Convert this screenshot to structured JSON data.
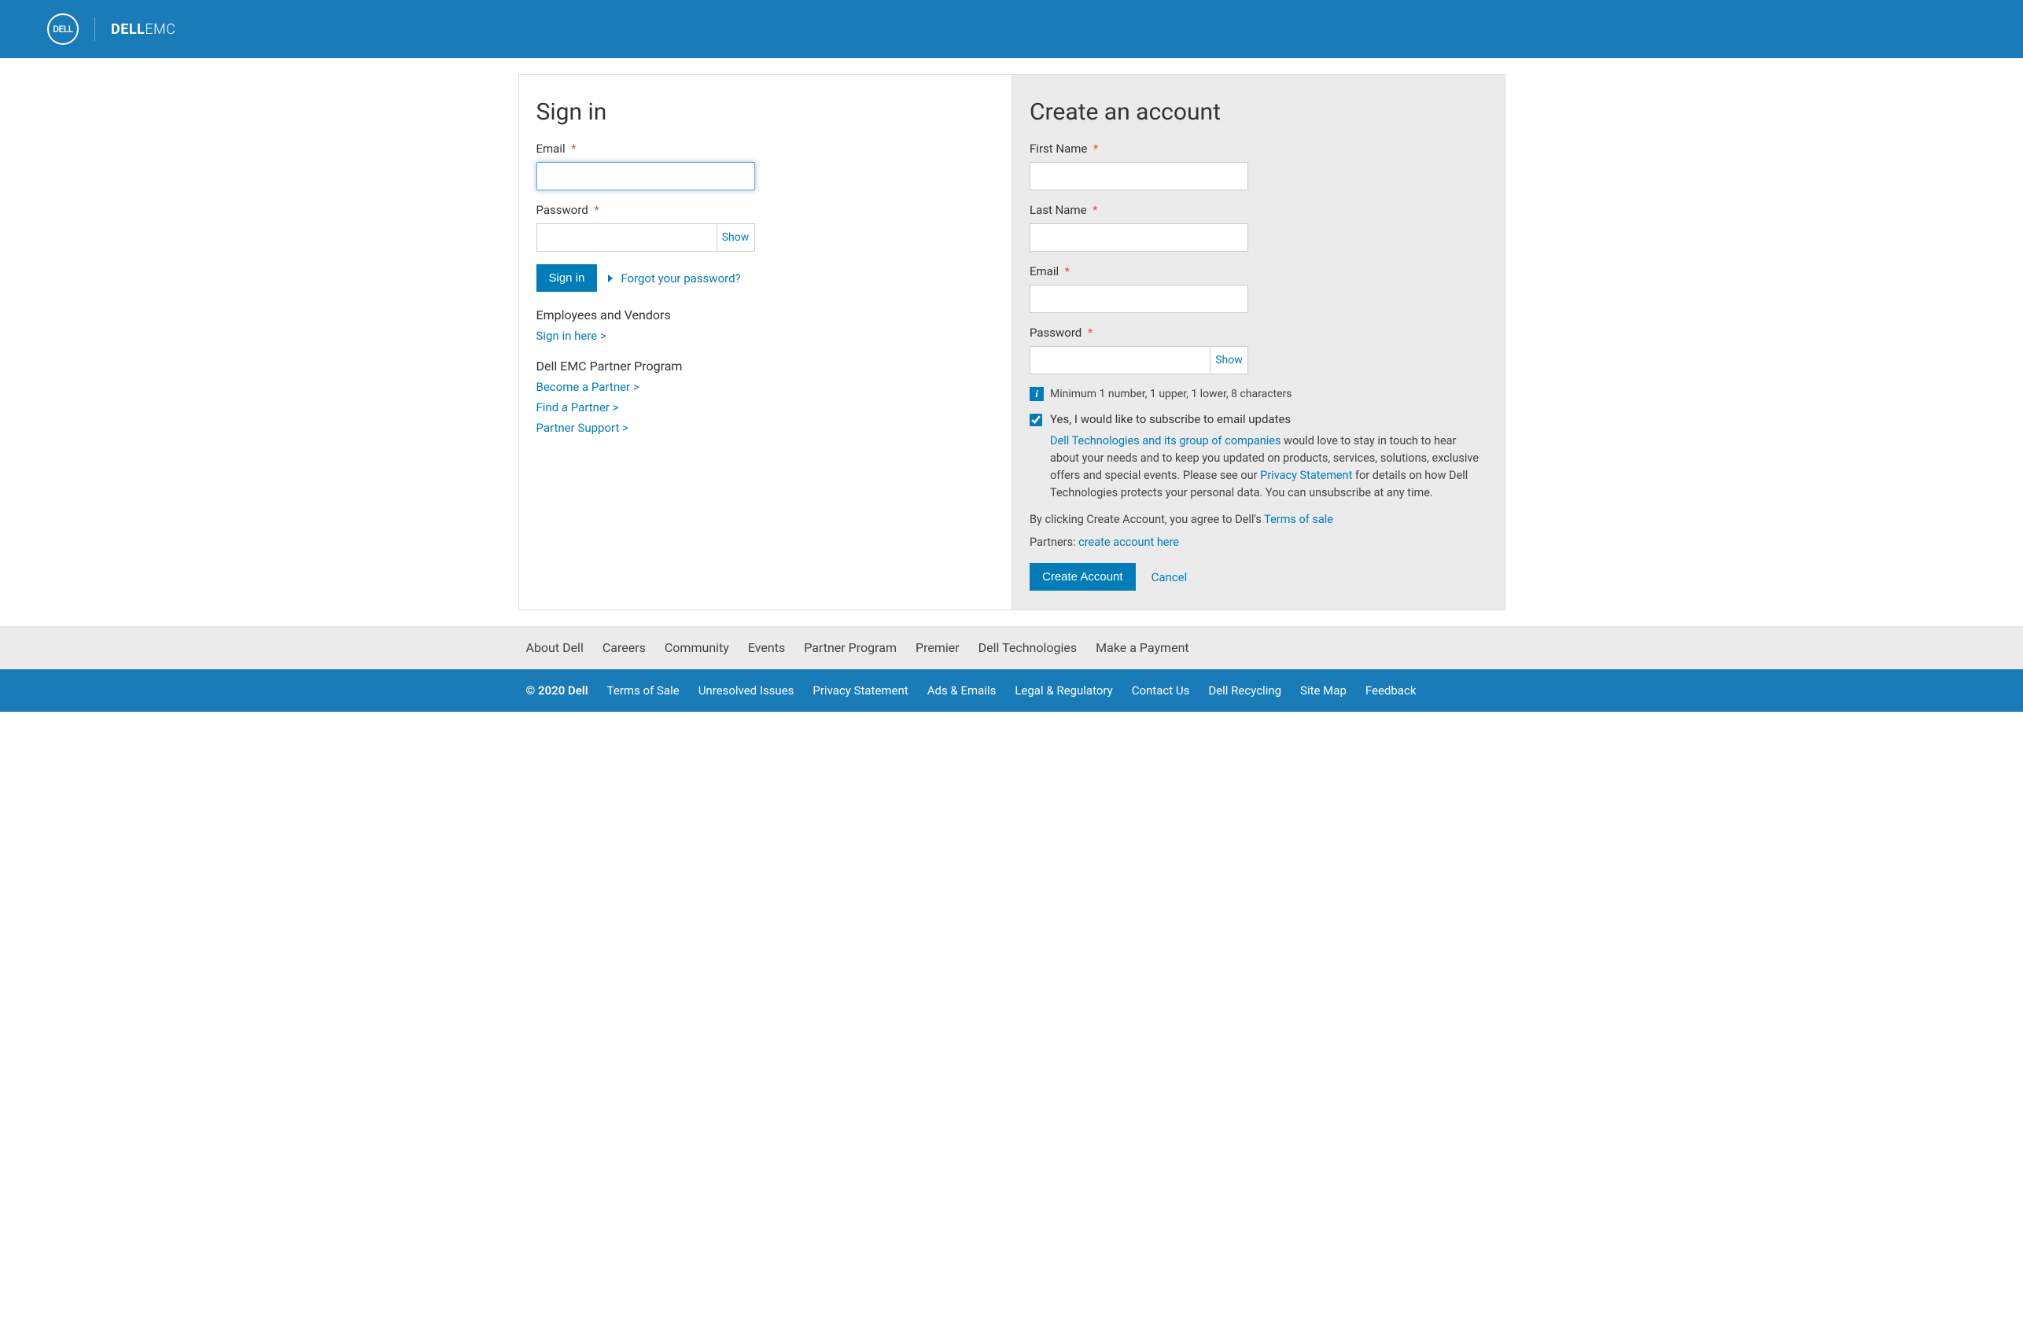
{
  "header": {
    "brand_circle": "DELL",
    "brand_text_bold": "DELL",
    "brand_text_light": "EMC"
  },
  "signin": {
    "title": "Sign in",
    "email_label": "Email",
    "password_label": "Password",
    "show_label": "Show",
    "signin_button": "Sign in",
    "forgot_link": "Forgot your password?",
    "employees_heading": "Employees and Vendors",
    "employees_link": "Sign in here >",
    "partner_heading": "Dell EMC Partner Program",
    "partner_links": {
      "become": "Become a Partner >",
      "find": "Find a Partner >",
      "support": "Partner Support >"
    }
  },
  "create": {
    "title": "Create an account",
    "first_name_label": "First Name",
    "last_name_label": "Last Name",
    "email_label": "Email",
    "password_label": "Password",
    "show_label": "Show",
    "password_hint": "Minimum 1 number, 1 upper, 1 lower, 8 characters",
    "subscribe_label": "Yes, I would like to subscribe to email updates",
    "consent_link1": "Dell Technologies and its group of companies",
    "consent_text1": " would love to stay in touch to hear about your needs and to keep you updated on products, services, solutions, exclusive offers and special events. Please see our ",
    "consent_link2": "Privacy Statement",
    "consent_text2": " for details on how Dell Technologies protects your personal data. You can unsubscribe at any time.",
    "terms_prefix": "By clicking Create Account, you agree to Dell's ",
    "terms_link": "Terms of sale",
    "partners_prefix": "Partners: ",
    "partners_link": "create account here",
    "create_button": "Create Account",
    "cancel_link": "Cancel"
  },
  "footer_nav": {
    "about": "About Dell",
    "careers": "Careers",
    "community": "Community",
    "events": "Events",
    "partner": "Partner Program",
    "premier": "Premier",
    "tech": "Dell Technologies",
    "payment": "Make a Payment"
  },
  "footer_legal": {
    "copyright": "© 2020 Dell",
    "terms": "Terms of Sale",
    "unresolved": "Unresolved Issues",
    "privacy": "Privacy Statement",
    "ads": "Ads & Emails",
    "legal": "Legal & Regulatory",
    "contact": "Contact Us",
    "recycling": "Dell Recycling",
    "sitemap": "Site Map",
    "feedback": "Feedback"
  }
}
